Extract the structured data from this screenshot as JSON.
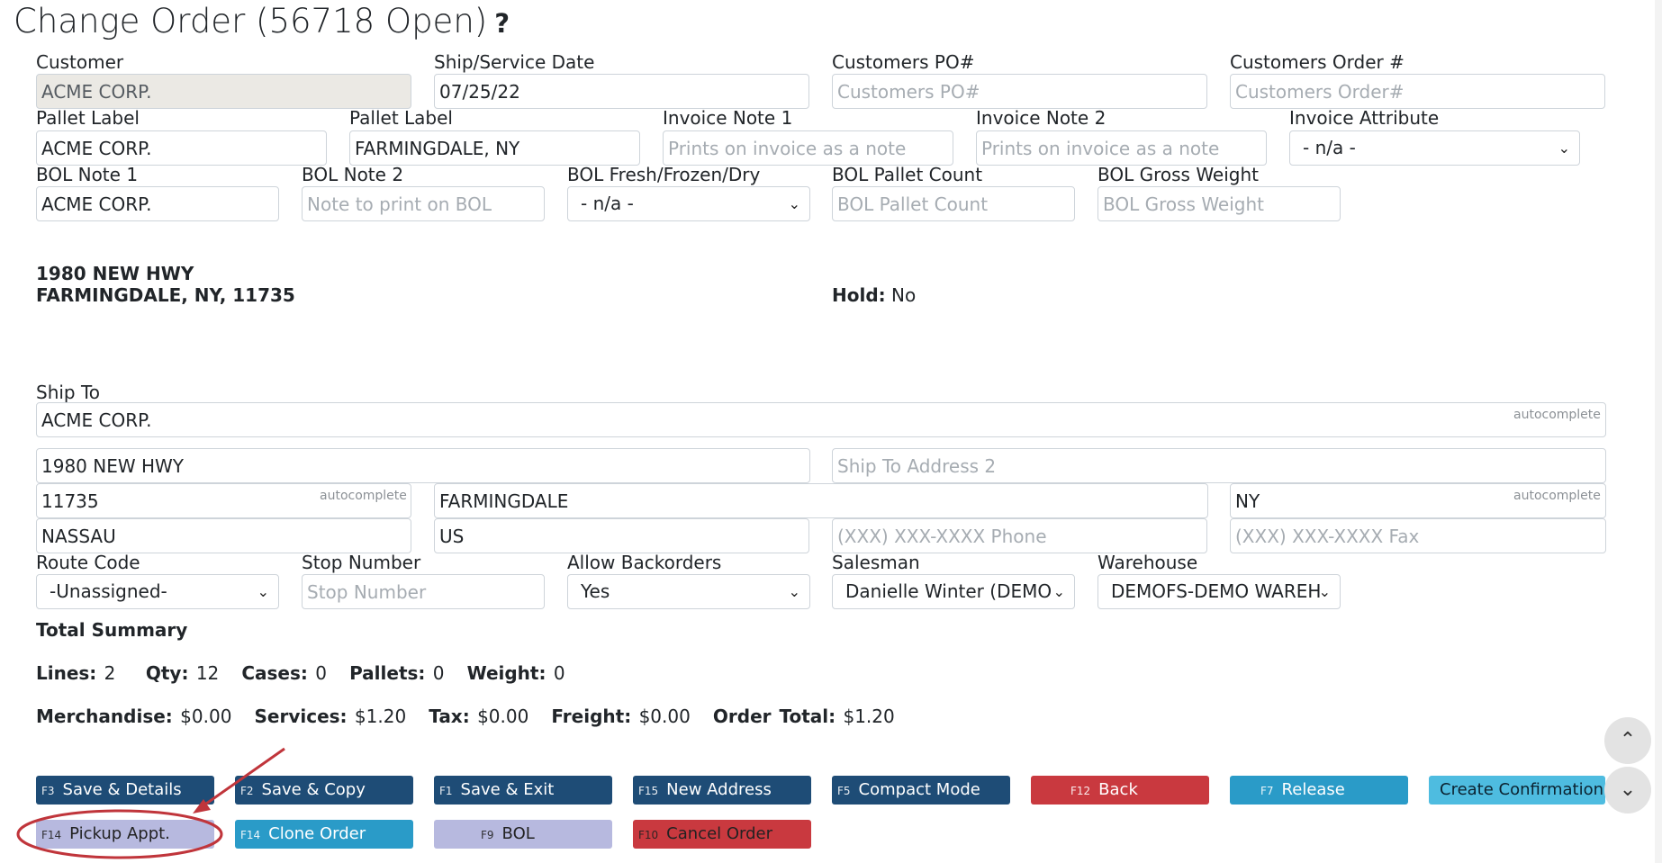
{
  "page": {
    "title": "Change Order (56718 Open)",
    "help_glyph": "?"
  },
  "labels": {
    "customer": "Customer",
    "ship_date": "Ship/Service Date",
    "customers_po": "Customers PO#",
    "customers_order": "Customers Order #",
    "pallet_label_1": "Pallet Label",
    "pallet_label_2": "Pallet Label",
    "invoice_note_1": "Invoice Note 1",
    "invoice_note_2": "Invoice Note 2",
    "invoice_attribute": "Invoice Attribute",
    "bol_note_1": "BOL Note 1",
    "bol_note_2": "BOL Note 2",
    "bol_fresh": "BOL Fresh/Frozen/Dry",
    "bol_pallet_count": "BOL Pallet Count",
    "bol_gross_weight": "BOL Gross Weight",
    "ship_to": "Ship To",
    "route_code": "Route Code",
    "stop_number": "Stop Number",
    "allow_backorders": "Allow Backorders",
    "salesman": "Salesman",
    "warehouse": "Warehouse"
  },
  "fields": {
    "customer": "ACME CORP.",
    "ship_date": "07/25/22",
    "customers_po_placeholder": "Customers PO#",
    "customers_order_placeholder": "Customers Order#",
    "pallet_label_1": "ACME CORP.",
    "pallet_label_2": "FARMINGDALE, NY",
    "invoice_note_1_placeholder": "Prints on invoice as a note",
    "invoice_note_2_placeholder": "Prints on invoice as a note",
    "invoice_attribute": "- n/a -",
    "bol_note_1": "ACME CORP.",
    "bol_note_2_placeholder": "Note to print on BOL",
    "bol_fresh": "- n/a -",
    "bol_pallet_count_placeholder": "BOL Pallet Count",
    "bol_gross_weight_placeholder": "BOL Gross Weight",
    "ship_to": "ACME CORP.",
    "address1": "1980 NEW HWY",
    "address2_placeholder": "Ship To Address 2",
    "zip": "11735",
    "city": "FARMINGDALE",
    "state": "NY",
    "county": "NASSAU",
    "country": "US",
    "phone_placeholder": "(XXX) XXX-XXXX Phone",
    "fax_placeholder": "(XXX) XXX-XXXX Fax",
    "route_code": "-Unassigned-",
    "stop_number_placeholder": "Stop Number",
    "allow_backorders": "Yes",
    "salesman": "Danielle Winter (DEMO",
    "warehouse": "DEMOFS-DEMO WAREH",
    "autocomplete_hint": "autocomplete"
  },
  "address_block": {
    "line1": "1980 NEW HWY",
    "line2": "FARMINGDALE, NY, 11735"
  },
  "hold": {
    "label": "Hold:",
    "value": "No"
  },
  "summary": {
    "heading": "Total Summary",
    "lines_label": "Lines:",
    "lines": "2",
    "qty_label": "Qty:",
    "qty": "12",
    "cases_label": "Cases:",
    "cases": "0",
    "pallets_label": "Pallets:",
    "pallets": "0",
    "weight_label": "Weight:",
    "weight": "0",
    "merch_label": "Merchandise:",
    "merch": "$0.00",
    "services_label": "Services:",
    "services": "$1.20",
    "tax_label": "Tax:",
    "tax": "$0.00",
    "freight_label": "Freight:",
    "freight": "$0.00",
    "total_label": "Order Total:",
    "total": "$1.20"
  },
  "buttons": {
    "save_details": {
      "key": "F3",
      "label": "Save & Details"
    },
    "save_copy": {
      "key": "F2",
      "label": "Save & Copy"
    },
    "save_exit": {
      "key": "F1",
      "label": "Save & Exit"
    },
    "new_address": {
      "key": "F15",
      "label": "New Address"
    },
    "compact_mode": {
      "key": "F5",
      "label": "Compact Mode"
    },
    "back": {
      "key": "F12",
      "label": "Back"
    },
    "release": {
      "key": "F7",
      "label": "Release"
    },
    "create_confirmation": {
      "label": "Create Confirmation"
    },
    "pickup_appt": {
      "key": "F14",
      "label": "Pickup Appt."
    },
    "clone_order": {
      "key": "F14",
      "label": "Clone Order"
    },
    "bol": {
      "key": "F9",
      "label": "BOL"
    },
    "cancel_order": {
      "key": "F10",
      "label": "Cancel Order"
    }
  },
  "colors": {
    "navy": "#1e4c76",
    "red": "#c9393f",
    "teal": "#2a9bc8",
    "lavender": "#b7b9df",
    "annotation_red": "#c0353b"
  }
}
